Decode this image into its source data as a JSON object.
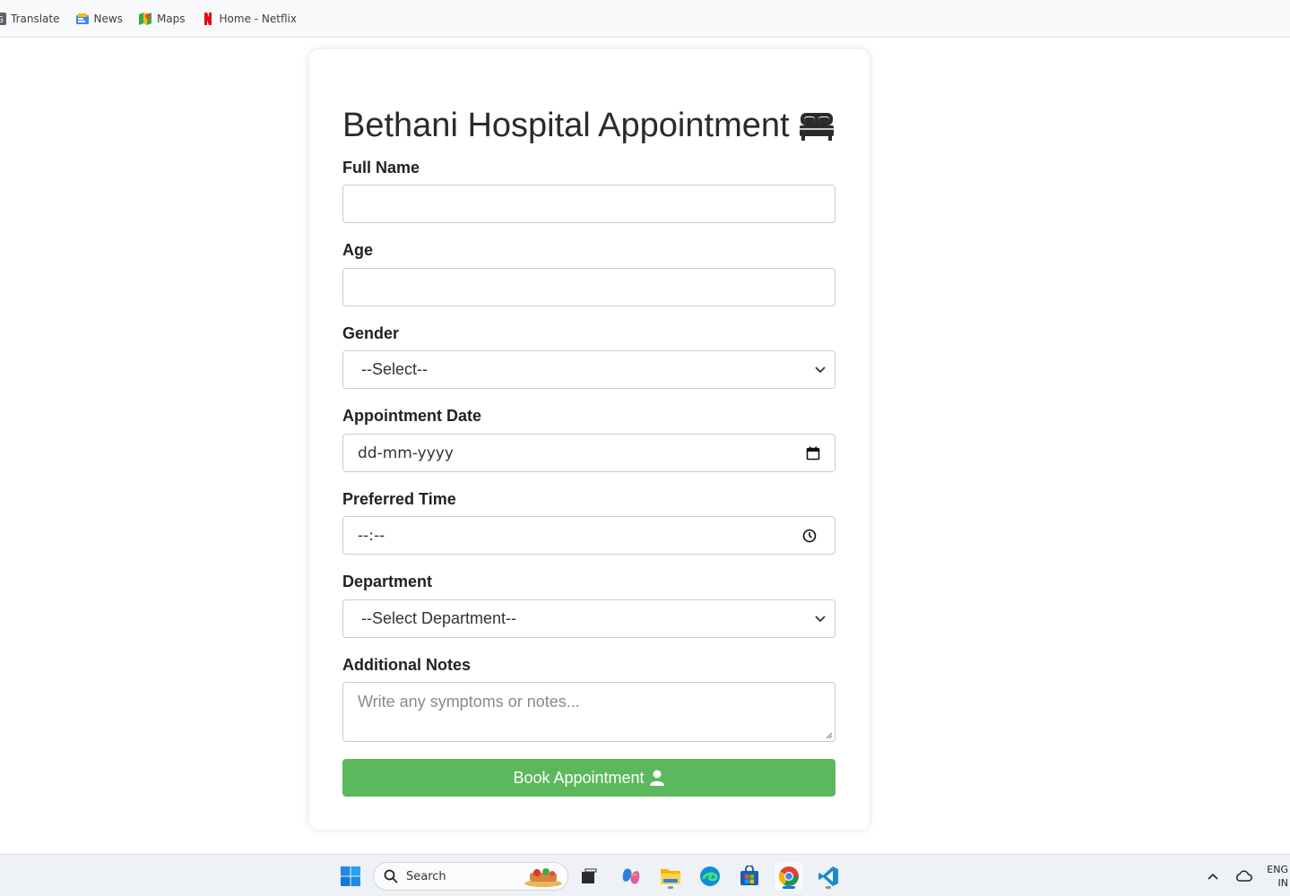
{
  "bookmarks": [
    {
      "label": "Translate",
      "icon": "translate-icon"
    },
    {
      "label": "News",
      "icon": "news-icon"
    },
    {
      "label": "Maps",
      "icon": "maps-icon"
    },
    {
      "label": "Home - Netflix",
      "icon": "netflix-icon"
    }
  ],
  "form": {
    "title": "Bethani Hospital Appointment",
    "full_name_label": "Full Name",
    "full_name_value": "",
    "age_label": "Age",
    "age_value": "",
    "gender_label": "Gender",
    "gender_selected": "--Select--",
    "date_label": "Appointment Date",
    "date_placeholder": "dd-mm-yyyy",
    "time_label": "Preferred Time",
    "time_placeholder": "--:--",
    "department_label": "Department",
    "department_selected": "--Select Department--",
    "notes_label": "Additional Notes",
    "notes_placeholder": "Write any symptoms or notes...",
    "submit_label": "Book Appointment"
  },
  "taskbar": {
    "search_placeholder": "Search",
    "lang_line1": "ENG",
    "lang_line2": "IN"
  },
  "colors": {
    "button": "#5cb85c",
    "title_text": "#2b2b2b"
  }
}
